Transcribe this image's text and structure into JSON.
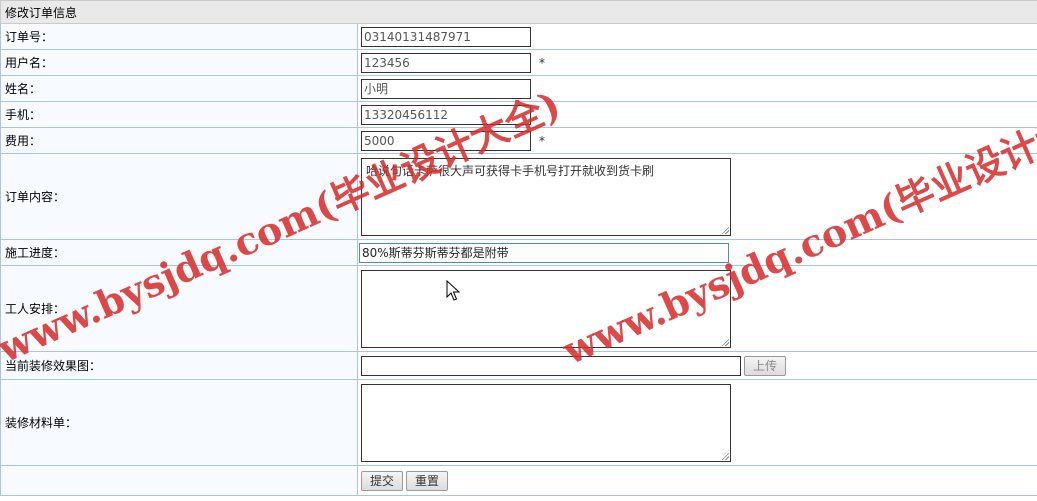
{
  "title": "修改订单信息",
  "fields": {
    "order_no": {
      "label": "订单号：",
      "value": "03140131487971"
    },
    "username": {
      "label": "用户名：",
      "value": "123456",
      "mark": "*"
    },
    "name": {
      "label": "姓名：",
      "value": "小明"
    },
    "phone": {
      "label": "手机：",
      "value": "13320456112"
    },
    "fee": {
      "label": "费用：",
      "value": "5000",
      "mark": "*"
    },
    "content": {
      "label": "订单内容：",
      "value": "哈说句话卡萨很大声可获得卡手机号打开就收到货卡刷"
    },
    "progress": {
      "label": "施工进度：",
      "value": "80%斯蒂芬斯蒂芬都是附带"
    },
    "workers": {
      "label": "工人安排：",
      "value": ""
    },
    "image": {
      "label": "当前装修效果图：",
      "value": "",
      "upload_label": "上传"
    },
    "materials": {
      "label": "装修材料单：",
      "value": ""
    }
  },
  "actions": {
    "submit_label": "提交",
    "reset_label": "重置"
  },
  "watermark": {
    "text": "www.bysjdq.com(毕业设计大全)",
    "color": "#d72828"
  }
}
